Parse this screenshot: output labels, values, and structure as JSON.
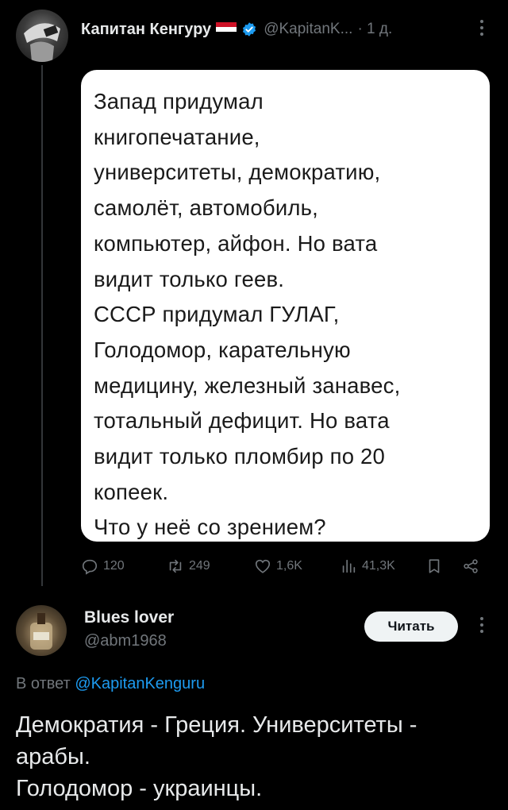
{
  "tweet": {
    "author_name": "Капитан Кенгуру",
    "handle": "@KapitanK...",
    "time": "· 1 д.",
    "card_lines": [
      "Запад придумал",
      "книгопечатание,",
      "университеты, демократию,",
      "самолёт, автомобиль,",
      "компьютер, айфон. Но вата",
      "видит только геев.",
      "СССР придумал ГУЛАГ,",
      "Голодомор, карательную",
      "медицину, железный занавес,",
      "тотальный дефицит. Но вата",
      "видит только пломбир по 20",
      "копеек.",
      "Что у неё со зрением?"
    ],
    "stats": {
      "replies": "120",
      "reposts": "249",
      "likes": "1,6K",
      "views": "41,3K"
    }
  },
  "reply": {
    "author_name": "Blues lover",
    "handle": "@abm1968",
    "follow_label": "Читать",
    "reply_prefix": "В ответ",
    "reply_to": "@KapitanKenguru",
    "text_lines": [
      "Демократия - Греция. Университеты -",
      "арабы.",
      "Голодомор - украинцы."
    ]
  },
  "colors": {
    "background": "#000000",
    "muted": "#71767b",
    "link": "#1d9bf0",
    "verified": "#1d9bf0"
  },
  "icons": [
    "reply-icon",
    "repost-icon",
    "like-icon",
    "views-icon",
    "bookmark-icon",
    "share-icon",
    "more-icon",
    "verified-icon",
    "flag-icon"
  ]
}
